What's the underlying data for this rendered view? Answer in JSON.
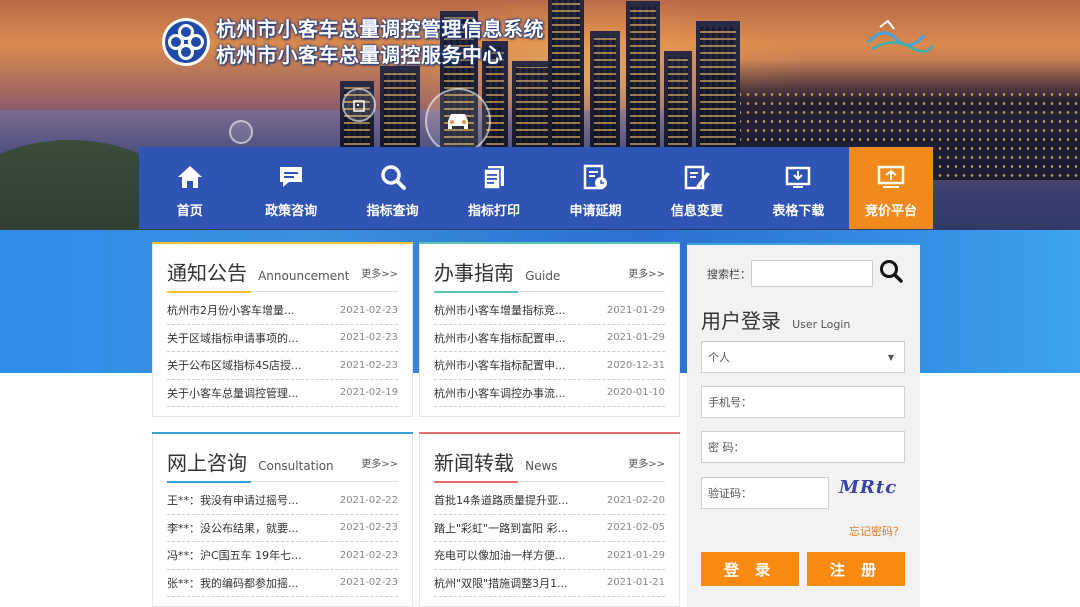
{
  "header": {
    "title_line1": "杭州市小客车总量调控管理信息系统",
    "title_line2": "杭州市小客车总量调控服务中心"
  },
  "nav": {
    "items": [
      {
        "label": "首页",
        "icon": "home-icon"
      },
      {
        "label": "政策咨询",
        "icon": "chat-icon"
      },
      {
        "label": "指标查询",
        "icon": "search-icon"
      },
      {
        "label": "指标打印",
        "icon": "document-icon"
      },
      {
        "label": "申请延期",
        "icon": "calendar-icon"
      },
      {
        "label": "信息变更",
        "icon": "edit-icon"
      },
      {
        "label": "表格下载",
        "icon": "download-icon"
      },
      {
        "label": "竞价平台",
        "icon": "bid-icon"
      }
    ],
    "active_index": 7
  },
  "colors": {
    "nav_bg": "#2f54b3",
    "nav_active": "#f08a1c",
    "button_orange": "#fb8a12",
    "notice_line": "#f1c232",
    "guide_line": "#59c3b4",
    "consult_line": "#3aa0d8",
    "news_line": "#e46d6d"
  },
  "notice": {
    "title": "通知公告",
    "subtitle": "Announcement",
    "more": "更多>>",
    "rows": [
      {
        "title": "杭州市2月份小客车增量...",
        "date": "2021-02-23"
      },
      {
        "title": "关于区域指标申请事项的...",
        "date": "2021-02-23"
      },
      {
        "title": "关于公布区域指标4S店授...",
        "date": "2021-02-23"
      },
      {
        "title": "关于小客车总量调控管理...",
        "date": "2021-02-19"
      }
    ]
  },
  "guide": {
    "title": "办事指南",
    "subtitle": "Guide",
    "more": "更多>>",
    "rows": [
      {
        "title": "杭州市小客车增量指标竞...",
        "date": "2021-01-29"
      },
      {
        "title": "杭州市小客车指标配置申...",
        "date": "2021-01-29"
      },
      {
        "title": "杭州市小客车指标配置申...",
        "date": "2020-12-31"
      },
      {
        "title": "杭州市小客车调控办事流...",
        "date": "2020-01-10"
      }
    ]
  },
  "consult": {
    "title": "网上咨询",
    "subtitle": "Consultation",
    "more": "更多>>",
    "rows": [
      {
        "title": "王**：我没有申请过摇号...",
        "date": "2021-02-22"
      },
      {
        "title": "李**：没公布结果，就要...",
        "date": "2021-02-23"
      },
      {
        "title": "冯**：沪C国五车 19年七...",
        "date": "2021-02-23"
      },
      {
        "title": "张**：我的编码都参加摇...",
        "date": "2021-02-23"
      }
    ]
  },
  "news": {
    "title": "新闻转载",
    "subtitle": "News",
    "more": "更多>>",
    "rows": [
      {
        "title": "首批14条道路质量提升亚...",
        "date": "2021-02-20"
      },
      {
        "title": "踏上\"彩虹\"一路到富阳 彩...",
        "date": "2021-02-05"
      },
      {
        "title": "充电可以像加油一样方便...",
        "date": "2021-01-29"
      },
      {
        "title": "杭州\"双限\"措施调整3月1...",
        "date": "2021-01-21"
      }
    ]
  },
  "login": {
    "search_label": "搜索栏：",
    "search_value": "",
    "title": "用户登录",
    "subtitle": "User Login",
    "user_type": "个人",
    "phone_placeholder": "手机号：",
    "password_placeholder": "密  码：",
    "captcha_placeholder": "验证码：",
    "captcha_text": "MRtc",
    "forgot": "忘记密码？",
    "login_button": "登 录",
    "register_button": "注 册"
  }
}
